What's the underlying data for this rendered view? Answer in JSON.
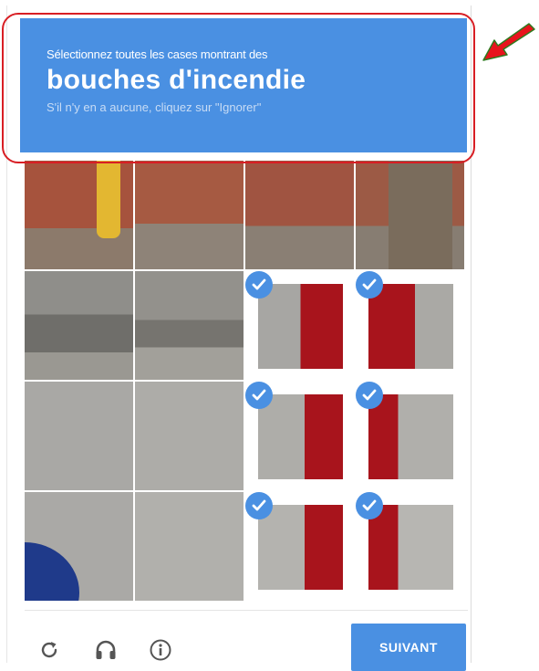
{
  "challenge": {
    "instruction": "Sélectionnez toutes les cases montrant des",
    "target": "bouches d'incendie",
    "hint": "S'il n'y en a aucune, cliquez sur \"Ignorer\""
  },
  "grid": {
    "rows": 4,
    "cols": 4,
    "selected_tiles": [
      {
        "row": 1,
        "col": 2
      },
      {
        "row": 1,
        "col": 3
      },
      {
        "row": 2,
        "col": 2
      },
      {
        "row": 2,
        "col": 3
      },
      {
        "row": 3,
        "col": 2
      },
      {
        "row": 3,
        "col": 3
      }
    ]
  },
  "footer": {
    "reload_icon": "reload-icon",
    "audio_icon": "headphones-icon",
    "info_icon": "info-icon",
    "verify_label": "SUIVANT"
  },
  "colors": {
    "accent": "#4a90e2",
    "highlight": "#d81e24",
    "hydrant": "#a8141c"
  }
}
